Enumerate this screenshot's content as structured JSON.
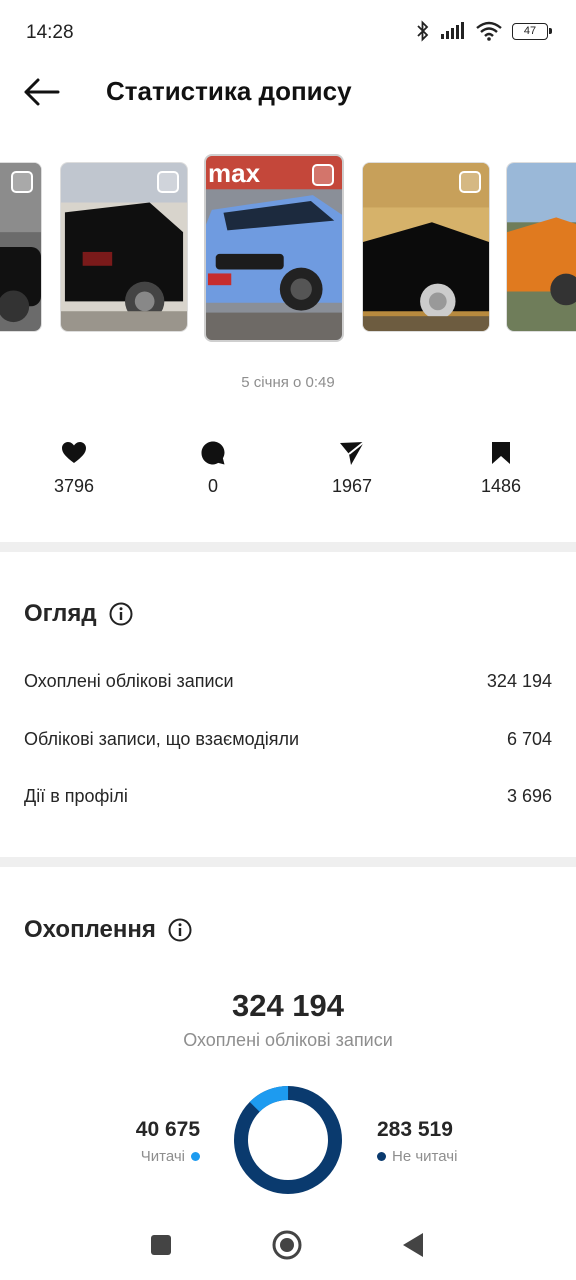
{
  "status": {
    "time": "14:28",
    "battery": "47",
    "icons": [
      "bluetooth-icon",
      "signal-icon",
      "wifi-icon",
      "battery-icon"
    ]
  },
  "header": {
    "title": "Статистика допису",
    "back_icon": "arrow-left-icon"
  },
  "thumbnails": {
    "active_index": 2,
    "items": [
      {
        "name": "black-sedan",
        "bg": "#6b6b6b",
        "car": "#111111",
        "active": false
      },
      {
        "name": "black-suv",
        "bg": "#d8d4cc",
        "car": "#0f0f0f",
        "active": false
      },
      {
        "name": "blue-wagon",
        "bg": "#8a8f98",
        "car": "#6f9be0",
        "active": true,
        "badge": "max"
      },
      {
        "name": "black-coupe",
        "bg": "#b88a3e",
        "car": "#0b0b0b",
        "active": false
      },
      {
        "name": "orange-coupe",
        "bg": "#9ab8d8",
        "car": "#e07a1f",
        "active": false
      }
    ]
  },
  "post": {
    "date": "5 січня о 0:49"
  },
  "engagement": {
    "likes": {
      "icon": "heart-icon",
      "value": "3796"
    },
    "comments": {
      "icon": "comment-icon",
      "value": "0"
    },
    "shares": {
      "icon": "send-icon",
      "value": "1967"
    },
    "saves": {
      "icon": "bookmark-icon",
      "value": "1486"
    }
  },
  "overview": {
    "title": "Огляд",
    "info_icon": "info-icon",
    "rows": [
      {
        "label": "Охоплені облікові записи",
        "value": "324 194"
      },
      {
        "label": "Облікові записи, що взаємодіяли",
        "value": "6 704"
      },
      {
        "label": "Дії в профілі",
        "value": "3 696"
      }
    ]
  },
  "reach": {
    "title": "Охоплення",
    "info_icon": "info-icon",
    "total": "324 194",
    "caption": "Охоплені облікові записи",
    "followers": {
      "value": "40 675",
      "label": "Читачі",
      "fraction": 0.1255,
      "color": "#1d9bf0"
    },
    "non_followers": {
      "value": "283 519",
      "label": "Не читачі",
      "fraction": 0.8745,
      "color": "#0a3a6e"
    }
  },
  "navigation": {
    "recent_icon": "square-icon",
    "home_icon": "circle-home-icon",
    "back_icon": "triangle-back-icon"
  }
}
